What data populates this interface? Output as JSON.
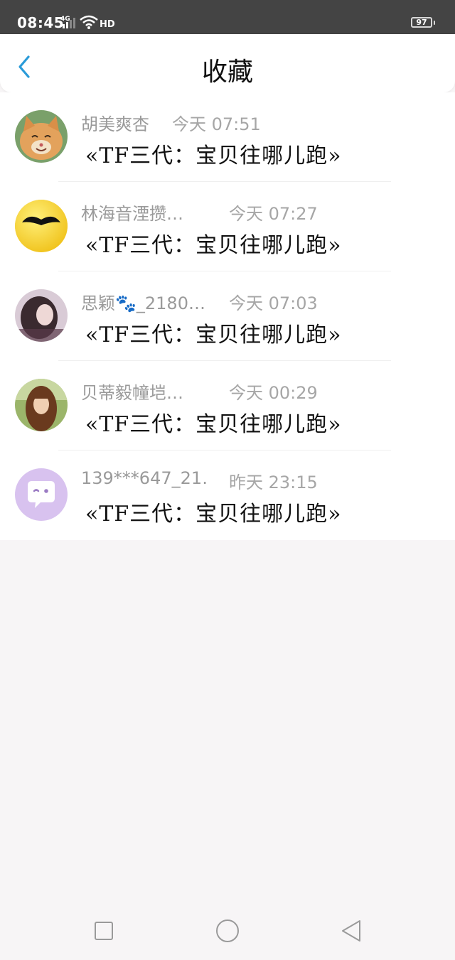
{
  "status_bar": {
    "time": "08:45",
    "network": "4G",
    "hd": "HD",
    "battery": "97"
  },
  "header": {
    "title": "收藏",
    "back_icon": "chevron-left-icon",
    "accent_color": "#2a9bd8"
  },
  "items": [
    {
      "name": "胡美爽杏",
      "time": "今天 07:51",
      "title": "«TF三代：宝贝往哪儿跑»",
      "avatar": "cat-photo"
    },
    {
      "name": "林海音湮攒…",
      "time": "今天 07:27",
      "title": "«TF三代：宝贝往哪儿跑»",
      "avatar": "mustache-face"
    },
    {
      "name": "思颖🐾_2180…",
      "time": "今天 07:03",
      "title": "«TF三代：宝贝往哪儿跑»",
      "avatar": "girl-photo"
    },
    {
      "name": "贝蒂毅幢垲…",
      "time": "今天 00:29",
      "title": "«TF三代：宝贝往哪儿跑»",
      "avatar": "girl-outdoor-photo"
    },
    {
      "name": "139***647_21…",
      "time": "昨天 23:15",
      "title": "«TF三代：宝贝往哪儿跑»",
      "avatar": "chat-bubble-face"
    }
  ],
  "nav_bar": {
    "recent_icon": "square-icon",
    "home_icon": "circle-icon",
    "back_icon": "triangle-back-icon"
  }
}
